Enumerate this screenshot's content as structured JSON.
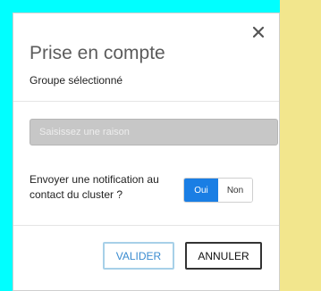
{
  "dialog": {
    "title": "Prise en compte",
    "subtitle": "Groupe sélectionné",
    "close_icon": "close-icon"
  },
  "reason": {
    "value": "",
    "placeholder": "Saisissez une raison"
  },
  "notification": {
    "label": "Envoyer une notification au contact du cluster ?",
    "options": [
      "Oui",
      "Non"
    ],
    "selected": "Oui"
  },
  "actions": {
    "validate_label": "VALIDER",
    "cancel_label": "ANNULER"
  },
  "colors": {
    "background_left": "#00ffff",
    "background_right": "#f2e68d",
    "toggle_active": "#1a7ee4",
    "validate_text": "#3a8bd0",
    "validate_border": "#a7d0e8"
  }
}
